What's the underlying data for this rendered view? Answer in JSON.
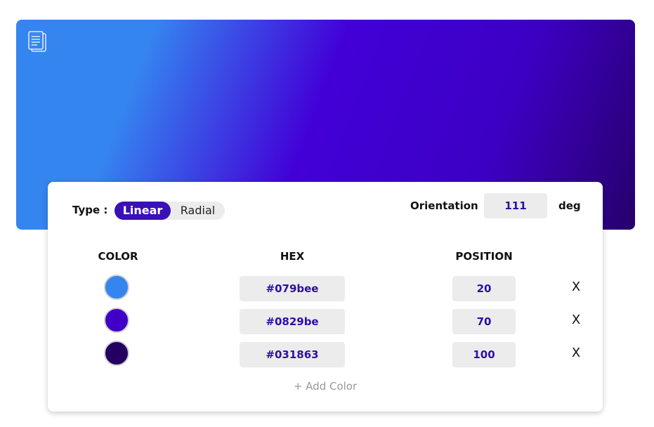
{
  "gradient": {
    "type": "linear",
    "stops": [
      {
        "hex": "#079bee",
        "position": "20"
      },
      {
        "hex": "#0829be",
        "position": "70"
      },
      {
        "hex": "#031863",
        "position": "100"
      }
    ]
  },
  "preview": {
    "copy_icon": "copy-icon"
  },
  "controls": {
    "type_label": "Type :",
    "type_options": [
      "Linear",
      "Radial"
    ],
    "selected_type": "Linear",
    "orientation_label": "Orientation",
    "orientation_value": "111",
    "orientation_unit": "deg"
  },
  "table": {
    "headers": [
      "COLOR",
      "HEX",
      "POSITION"
    ],
    "rows": [
      {
        "swatch_color": "#3585f0",
        "hex": "#079bee",
        "position": "20",
        "remove": "X"
      },
      {
        "swatch_color": "#4100c8",
        "hex": "#0829be",
        "position": "70",
        "remove": "X"
      },
      {
        "swatch_color": "#230061",
        "hex": "#031863",
        "position": "100",
        "remove": "X"
      }
    ],
    "add_label": "+ Add Color"
  },
  "colors": {
    "accent": "#3a10b8",
    "value_text": "#2f0fa5",
    "field_bg": "#ececec"
  }
}
